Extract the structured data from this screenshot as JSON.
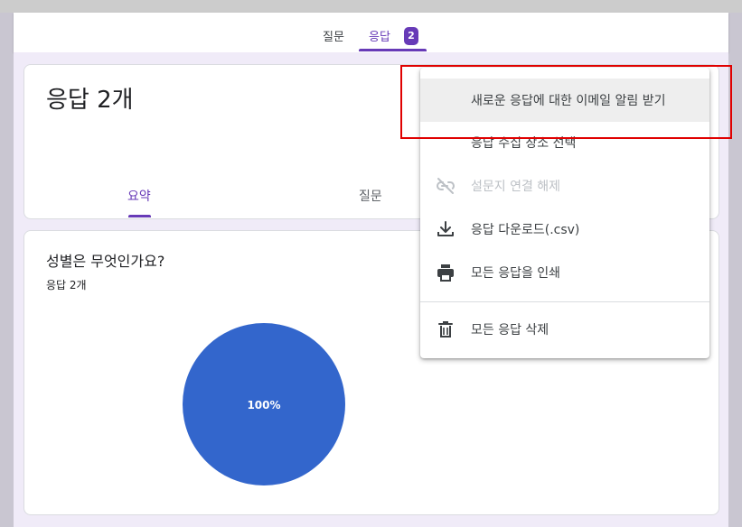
{
  "tabs": [
    {
      "label": "질문",
      "active": false
    },
    {
      "label": "응답",
      "active": true,
      "badge": "2"
    }
  ],
  "header": {
    "title": "응답 2개",
    "subtabs": [
      {
        "label": "요약",
        "active": true
      },
      {
        "label": "질문",
        "active": false
      }
    ]
  },
  "question": {
    "title": "성별은 무엇인가요?",
    "count": "응답 2개"
  },
  "chart_data": {
    "type": "pie",
    "slices": [
      {
        "value": 100,
        "color": "#3366cc"
      }
    ],
    "data_label": "100%"
  },
  "menu": {
    "items": [
      {
        "label": "새로운 응답에 대한 이메일 알림 받기",
        "icon": "none",
        "highlighted": true,
        "disabled": false
      },
      {
        "label": "응답 수집 장소 선택",
        "icon": "none",
        "disabled": false
      },
      {
        "label": "설문지 연결 해제",
        "icon": "link-off-icon",
        "disabled": true
      },
      {
        "label": "응답 다운로드(.csv)",
        "icon": "download-icon",
        "disabled": false
      },
      {
        "label": "모든 응답을 인쇄",
        "icon": "print-icon",
        "disabled": false
      },
      {
        "label": "모든 응답 삭제",
        "icon": "trash-icon",
        "disabled": false
      }
    ]
  },
  "colors": {
    "accent": "#673ab7",
    "pie": "#3366cc",
    "highlight_box": "#e00000"
  }
}
